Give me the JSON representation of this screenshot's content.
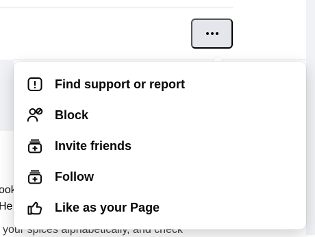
{
  "background": {
    "partial_text_line_1": "ook",
    "partial_text_line_2": "He",
    "partial_text_line_3": "your spices alphabetically, and check"
  },
  "toolbar": {
    "more_button_icon": "ellipsis-icon"
  },
  "menu": {
    "items": [
      {
        "label": "Find support or report",
        "icon": "report-icon"
      },
      {
        "label": "Block",
        "icon": "block-user-icon"
      },
      {
        "label": "Invite friends",
        "icon": "invite-friends-icon"
      },
      {
        "label": "Follow",
        "icon": "follow-icon"
      },
      {
        "label": "Like as your Page",
        "icon": "thumbs-up-icon"
      }
    ]
  }
}
